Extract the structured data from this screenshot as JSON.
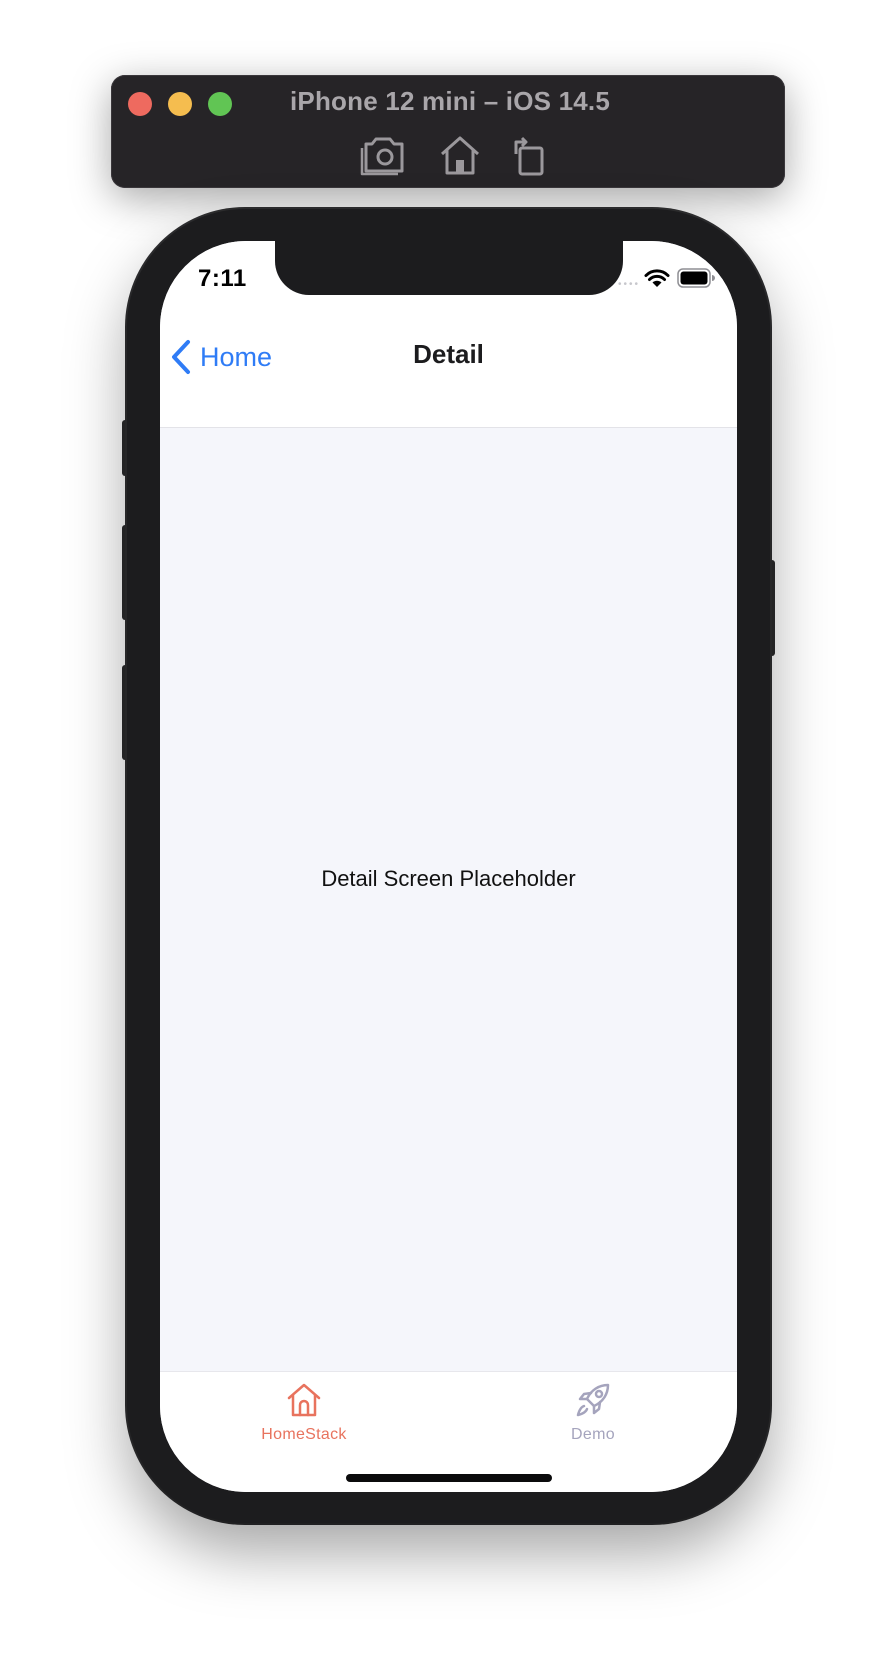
{
  "simulator": {
    "title": "iPhone 12 mini – iOS 14.5",
    "toolbar": [
      {
        "name": "screenshot",
        "icon": "camera-icon"
      },
      {
        "name": "home",
        "icon": "home-icon"
      },
      {
        "name": "rotate",
        "icon": "rotate-icon"
      }
    ]
  },
  "status_bar": {
    "time": "7:11",
    "icons": [
      "wifi-icon",
      "battery-icon"
    ]
  },
  "nav": {
    "back_label": "Home",
    "title": "Detail",
    "accent": "#2f7cf6"
  },
  "content": {
    "placeholder_text": "Detail Screen Placeholder"
  },
  "tab_bar": {
    "tabs": [
      {
        "label": "HomeStack",
        "icon": "home-icon",
        "active": true,
        "color": "#e8735e"
      },
      {
        "label": "Demo",
        "icon": "rocket-icon",
        "active": false,
        "color": "#a5a4bd"
      }
    ]
  }
}
